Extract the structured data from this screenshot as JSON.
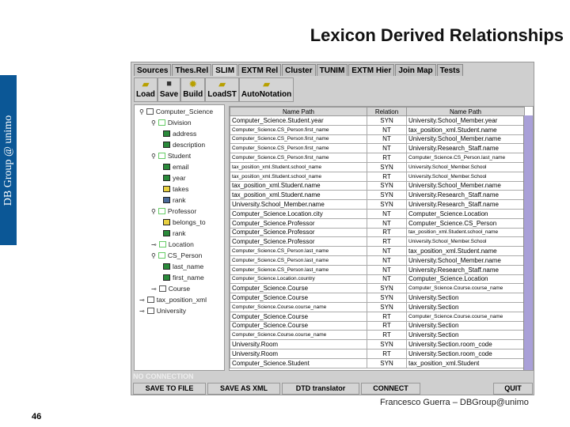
{
  "slide": {
    "title": "Lexicon Derived Relationships",
    "side_label": "DB Group @ unimo",
    "footer": "Francesco Guerra – DBGroup@unimo",
    "page_number": "46"
  },
  "tabs": [
    "Sources",
    "Thes.Rel",
    "SLIM",
    "EXTM Rel",
    "Cluster",
    "TUNIM",
    "EXTM Hier",
    "Join Map",
    "Tests"
  ],
  "active_tab": "SLIM",
  "toolbar": [
    {
      "label": "Load",
      "icon": "folder-open-icon"
    },
    {
      "label": "Save",
      "icon": "save-icon"
    },
    {
      "label": "Build",
      "icon": "build-icon"
    },
    {
      "label": "LoadST",
      "icon": "folder-open-icon"
    },
    {
      "label": "AutoNotation",
      "icon": "folder-open-icon"
    }
  ],
  "tree": [
    {
      "label": "Computer_Science",
      "level": 0,
      "type": "folder"
    },
    {
      "label": "Division",
      "level": 1,
      "type": "class"
    },
    {
      "label": "address",
      "level": 2,
      "type": "attr-green"
    },
    {
      "label": "description",
      "level": 2,
      "type": "attr-green"
    },
    {
      "label": "Student",
      "level": 1,
      "type": "class"
    },
    {
      "label": "email",
      "level": 2,
      "type": "attr-green"
    },
    {
      "label": "year",
      "level": 2,
      "type": "attr-green"
    },
    {
      "label": "takes",
      "level": 2,
      "type": "attr-yellow"
    },
    {
      "label": "rank",
      "level": 2,
      "type": "attr-blue"
    },
    {
      "label": "Professor",
      "level": 1,
      "type": "class"
    },
    {
      "label": "belongs_to",
      "level": 2,
      "type": "attr-yellow"
    },
    {
      "label": "rank",
      "level": 2,
      "type": "attr-green"
    },
    {
      "label": "Location",
      "level": 1,
      "type": "class"
    },
    {
      "label": "CS_Person",
      "level": 1,
      "type": "class"
    },
    {
      "label": "last_name",
      "level": 2,
      "type": "attr-green"
    },
    {
      "label": "first_name",
      "level": 2,
      "type": "attr-green"
    },
    {
      "label": "Course",
      "level": 1,
      "type": "class-gray"
    },
    {
      "label": "tax_position_xml",
      "level": 0,
      "type": "folder"
    },
    {
      "label": "University",
      "level": 0,
      "type": "folder"
    }
  ],
  "table": {
    "headers": [
      "Name Path",
      "Relation",
      "Name Path"
    ],
    "rows": [
      [
        "Computer_Science.Student.year",
        "SYN",
        "University.School_Member.year"
      ],
      [
        "Computer_Science.CS_Person.first_name",
        "NT",
        "tax_position_xml.Student.name"
      ],
      [
        "Computer_Science.CS_Person.first_name",
        "NT",
        "University.School_Member.name"
      ],
      [
        "Computer_Science.CS_Person.first_name",
        "NT",
        "University.Research_Staff.name"
      ],
      [
        "Computer_Science.CS_Person.first_name",
        "RT",
        "Computer_Science.CS_Person.last_name"
      ],
      [
        "tax_position_xml.Student.school_name",
        "SYN",
        "University.School_Member.School"
      ],
      [
        "tax_position_xml.Student.school_name",
        "RT",
        "University.School_Member.School"
      ],
      [
        "tax_position_xml.Student.name",
        "SYN",
        "University.School_Member.name"
      ],
      [
        "tax_position_xml.Student.name",
        "SYN",
        "University.Research_Staff.name"
      ],
      [
        "University.School_Member.name",
        "SYN",
        "University.Research_Staff.name"
      ],
      [
        "Computer_Science.Location.city",
        "NT",
        "Computer_Science.Location"
      ],
      [
        "Computer_Science.Professor",
        "NT",
        "Computer_Science.CS_Person"
      ],
      [
        "Computer_Science.Professor",
        "RT",
        "tax_position_xml.Student.school_name"
      ],
      [
        "Computer_Science.Professor",
        "RT",
        "University.School_Member.School"
      ],
      [
        "Computer_Science.CS_Person.last_name",
        "NT",
        "tax_position_xml.Student.name"
      ],
      [
        "Computer_Science.CS_Person.last_name",
        "NT",
        "University.School_Member.name"
      ],
      [
        "Computer_Science.CS_Person.last_name",
        "NT",
        "University.Research_Staff.name"
      ],
      [
        "Computer_Science.Location.country",
        "NT",
        "Computer_Science.Location"
      ],
      [
        "Computer_Science.Course",
        "SYN",
        "Computer_Science.Course.course_name"
      ],
      [
        "Computer_Science.Course",
        "SYN",
        "University.Section"
      ],
      [
        "Computer_Science.Course.course_name",
        "SYN",
        "University.Section"
      ],
      [
        "Computer_Science.Course",
        "RT",
        "Computer_Science.Course.course_name"
      ],
      [
        "Computer_Science.Course",
        "RT",
        "University.Section"
      ],
      [
        "Computer_Science.Course.course_name",
        "RT",
        "University.Section"
      ],
      [
        "University.Room",
        "SYN",
        "University.Section.room_code"
      ],
      [
        "University.Room",
        "RT",
        "University.Section.room_code"
      ],
      [
        "Computer_Science.Student",
        "SYN",
        "tax_position_xml.Student"
      ]
    ]
  },
  "status": "NO CONNECTION",
  "buttons": [
    "SAVE TO FILE",
    "SAVE AS XML",
    "DTD translator",
    "CONNECT",
    "QUIT"
  ],
  "colors": {
    "side_band": "#0b5796",
    "scrollbar": "#a9a0d8"
  }
}
